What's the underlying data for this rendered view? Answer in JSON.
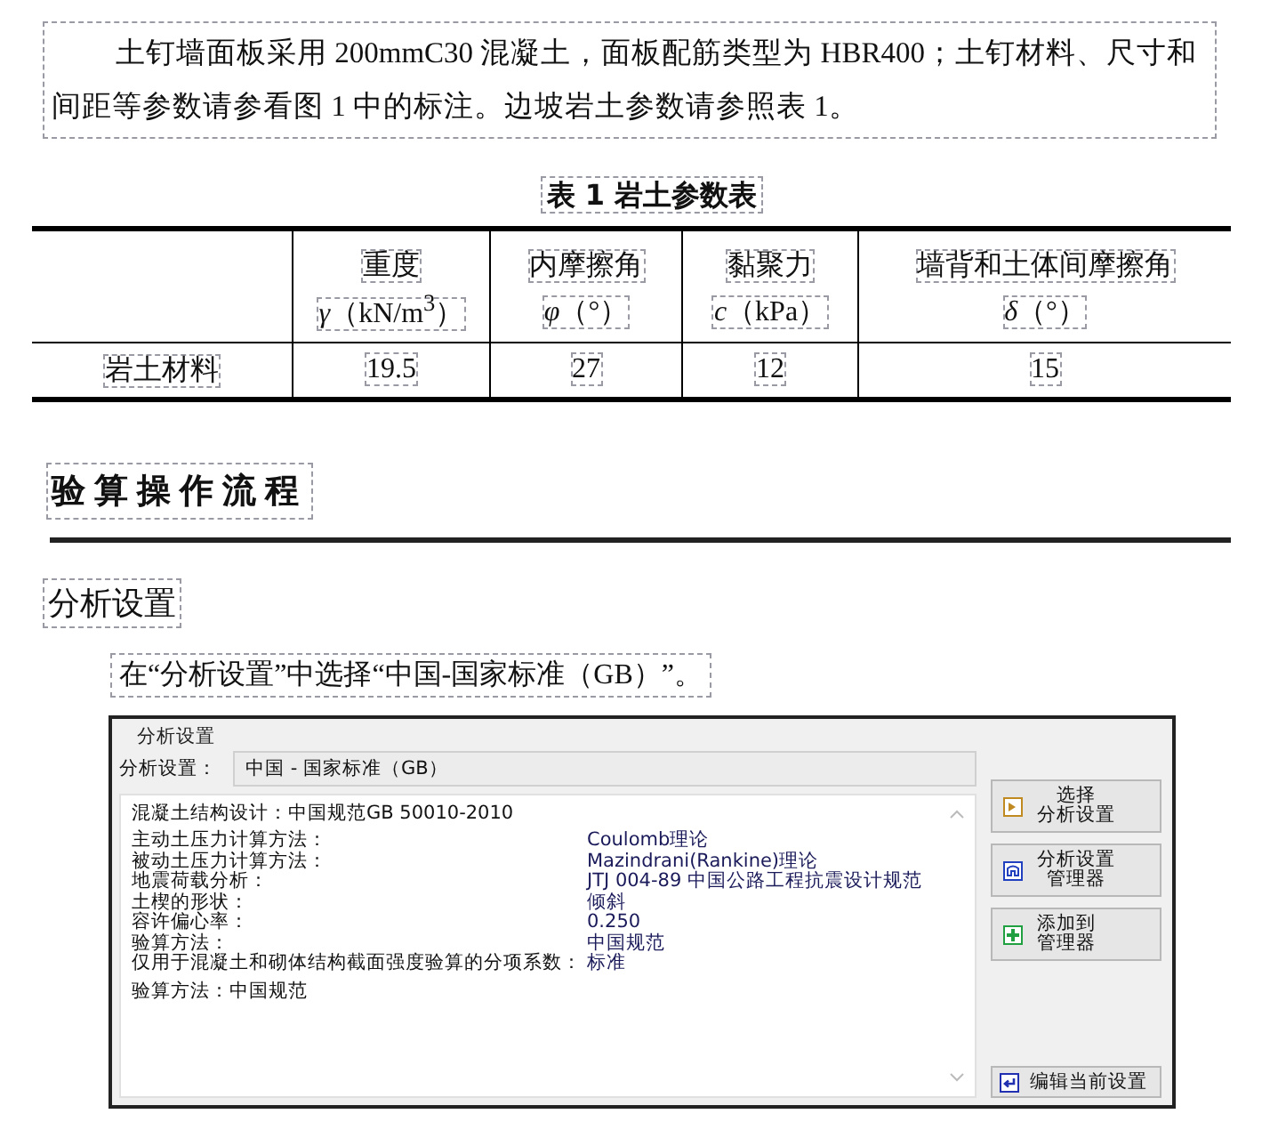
{
  "paragraph": "土钉墙面板采用 200mmC30 混凝土，面板配筋类型为 HBR400；土钉材料、尺寸和间距等参数请参看图 1 中的标注。边坡岩土参数请参照表 1。",
  "table": {
    "title": "表 1  岩土参数表",
    "columns": [
      {
        "name": "重度",
        "unit": "*γ*（kN/m$^{3}$）"
      },
      {
        "name": "内摩擦角",
        "unit": "*φ*（°）"
      },
      {
        "name": "黏聚力",
        "unit": "*c*（kPa）"
      },
      {
        "name": "墙背和土体间摩擦角",
        "unit": "*δ*（°）"
      }
    ],
    "rows": [
      {
        "label": "岩土材料",
        "cells": [
          "19.5",
          "27",
          "12",
          "15"
        ]
      }
    ]
  },
  "section_heading": "验算操作流程",
  "subheading": "分析设置",
  "instruction": "在“分析设置”中选择“中国-国家标准（GB）”。",
  "dialog": {
    "group_title": "分析设置",
    "setting_label": "分析设置：",
    "setting_value": "中国 - 国家标准（GB）",
    "summary_line": "混凝土结构设计：中国规范GB 50010-2010",
    "params": [
      {
        "label": "主动土压力计算方法：",
        "value": "Coulomb理论"
      },
      {
        "label": "被动土压力计算方法：",
        "value": "Mazindrani(Rankine)理论"
      },
      {
        "label": "地震荷载分析：",
        "value": "JTJ 004-89 中国公路工程抗震设计规范"
      },
      {
        "label": "土楔的形状：",
        "value": "倾斜"
      },
      {
        "label": "容许偏心率：",
        "value": "0.250"
      },
      {
        "label": "验算方法：",
        "value": "中国规范"
      },
      {
        "label": "仅用于混凝土和砌体结构截面强度验算的分项系数：",
        "value": "标准"
      }
    ],
    "footer_line": "验算方法：中国规范",
    "buttons": [
      {
        "lines": [
          "选择",
          "分析设置"
        ],
        "kind": "select"
      },
      {
        "lines": [
          "分析设置",
          "管理器"
        ],
        "kind": "manager"
      },
      {
        "lines": [
          "添加到",
          "管理器"
        ],
        "kind": "add"
      },
      {
        "lines": [
          "编辑当前设置"
        ],
        "kind": "edit"
      }
    ]
  }
}
